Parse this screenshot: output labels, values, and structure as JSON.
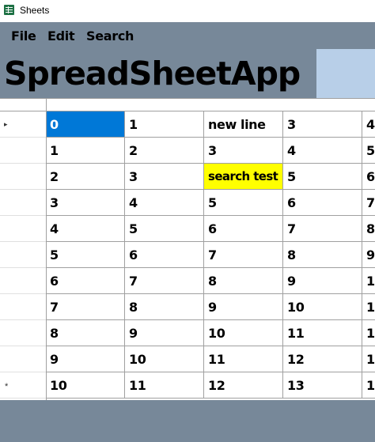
{
  "window": {
    "title": "Sheets",
    "icon": "spreadsheet-icon"
  },
  "menu": {
    "items": [
      "File",
      "Edit",
      "Search"
    ]
  },
  "header": {
    "app_title": "SpreadSheetApp"
  },
  "colors": {
    "chrome": "#778899",
    "header_box": "#b8cfe8",
    "selection": "#0078d7",
    "search_highlight": "#ffff00"
  },
  "grid": {
    "current_row_marker": "▸",
    "new_row_marker": "*",
    "selected_cell": [
      0,
      0
    ],
    "highlighted_cells": [
      [
        2,
        2
      ]
    ],
    "rows": [
      [
        "0",
        "1",
        "new line",
        "3",
        "4"
      ],
      [
        "1",
        "2",
        "3",
        "4",
        "5"
      ],
      [
        "2",
        "3",
        "search test",
        "5",
        "6"
      ],
      [
        "3",
        "4",
        "5",
        "6",
        "7"
      ],
      [
        "4",
        "5",
        "6",
        "7",
        "8"
      ],
      [
        "5",
        "6",
        "7",
        "8",
        "9"
      ],
      [
        "6",
        "7",
        "8",
        "9",
        "1"
      ],
      [
        "7",
        "8",
        "9",
        "10",
        "1"
      ],
      [
        "8",
        "9",
        "10",
        "11",
        "1"
      ],
      [
        "9",
        "10",
        "11",
        "12",
        "1"
      ],
      [
        "10",
        "11",
        "12",
        "13",
        "1"
      ]
    ]
  }
}
